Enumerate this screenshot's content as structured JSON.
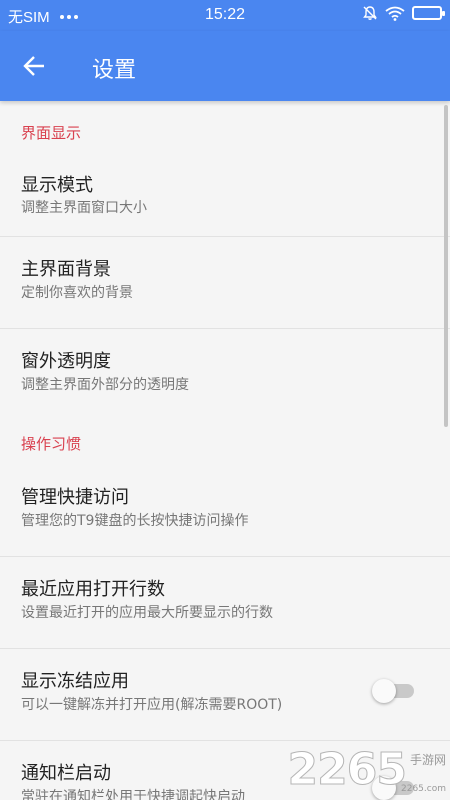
{
  "statusbar": {
    "carrier": "无SIM",
    "time": "15:22",
    "icons": [
      "more-dots-icon",
      "silent-icon",
      "wifi-icon",
      "battery-icon"
    ]
  },
  "appbar": {
    "title": "设置",
    "back_icon": "arrow-left-icon"
  },
  "sections": [
    {
      "header": "界面显示",
      "items": [
        {
          "title": "显示模式",
          "subtitle": "调整主界面窗口大小"
        },
        {
          "title": "主界面背景",
          "subtitle": "定制你喜欢的背景"
        },
        {
          "title": "窗外透明度",
          "subtitle": "调整主界面外部分的透明度"
        }
      ]
    },
    {
      "header": "操作习惯",
      "items": [
        {
          "title": "管理快捷访问",
          "subtitle": "管理您的T9键盘的长按快捷访问操作"
        },
        {
          "title": "最近应用打开行数",
          "subtitle": "设置最近打开的应用最大所要显示的行数"
        },
        {
          "title": "显示冻结应用",
          "subtitle": "可以一键解冻并打开应用(解冻需要ROOT)",
          "toggle": false
        },
        {
          "title": "通知栏启动",
          "subtitle": "常驻在通知栏处用于快捷调起快启动"
        }
      ]
    }
  ],
  "watermark": {
    "number": "2265",
    "text": "手游网",
    "url": "2265.com"
  },
  "colors": {
    "primary": "#4a86f0",
    "section_header": "#d9414f",
    "title_text": "#222222",
    "subtitle_text": "#777777",
    "divider": "#e2e2e2",
    "background": "#f5f5f5"
  }
}
